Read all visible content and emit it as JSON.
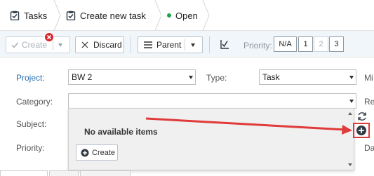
{
  "breadcrumb": {
    "tasks_label": "Tasks",
    "create_label": "Create new task",
    "status_label": "Open"
  },
  "toolbar": {
    "create_label": "Create",
    "discard_label": "Discard",
    "parent_label": "Parent",
    "priority_label": "Priority:",
    "priority_options": [
      "N/A",
      "1",
      "2",
      "3"
    ]
  },
  "form": {
    "project_label": "Project:",
    "project_value": "BW 2",
    "type_label": "Type:",
    "type_value": "Task",
    "category_label": "Category:",
    "category_value": "",
    "subject_label": "Subject:",
    "priority_label": "Priority:",
    "right_label_1": "Mi",
    "right_label_2": "Re",
    "right_label_3": "Da"
  },
  "dropdown": {
    "empty_text": "No available items",
    "create_label": "Create"
  },
  "colors": {
    "accent": "#2a6fb0",
    "status_dot": "#1fa34a",
    "annotation_red": "#e03a3a",
    "error_badge": "#d9262c"
  }
}
